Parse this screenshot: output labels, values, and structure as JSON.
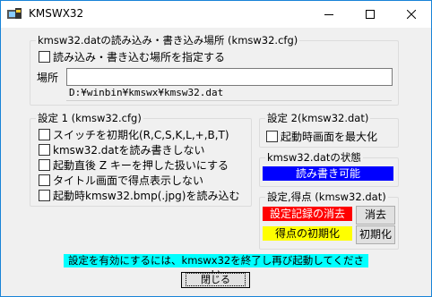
{
  "window": {
    "title": "KMSWX32"
  },
  "location_group": {
    "legend": "kmsw32.datの読み込み・書き込み場所 (kmsw32.cfg)",
    "specify_checkbox_label": "読み込み・書き込む場所を指定する",
    "location_label": "場所",
    "location_value": "",
    "current_path": "D:¥winbin¥kmswx¥kmsw32.dat"
  },
  "settings1": {
    "legend": "設定 1 (kmsw32.cfg)",
    "options": [
      "スイッチを初期化(R,C,S,K,L,+,B,T)",
      "kmsw32.datを読み書きしない",
      "起動直後 Z キーを押した扱いにする",
      "タイトル画面で得点表示しない",
      "起動時kmsw32.bmp(.jpg)を読み込む"
    ]
  },
  "settings2": {
    "legend": "設定 2(kmsw32.dat)",
    "maximize_label": "起動時画面を最大化"
  },
  "status_group": {
    "legend": "kmsw32.datの状態",
    "status_text": "読み書き可能",
    "status_color": "#0000ff"
  },
  "score_group": {
    "legend": "設定,得点 (kmsw32.dat)",
    "clear_record_label": "設定記録の消去",
    "clear_record_color": "#ff0000",
    "clear_button": "消去",
    "reset_score_label": "得点の初期化",
    "reset_score_color": "#ffff00",
    "reset_button": "初期化"
  },
  "notice": {
    "text": "設定を有効にするには、kmswx32を終了し再び起動してください",
    "color": "#00ffff"
  },
  "close_button": "閉じる"
}
